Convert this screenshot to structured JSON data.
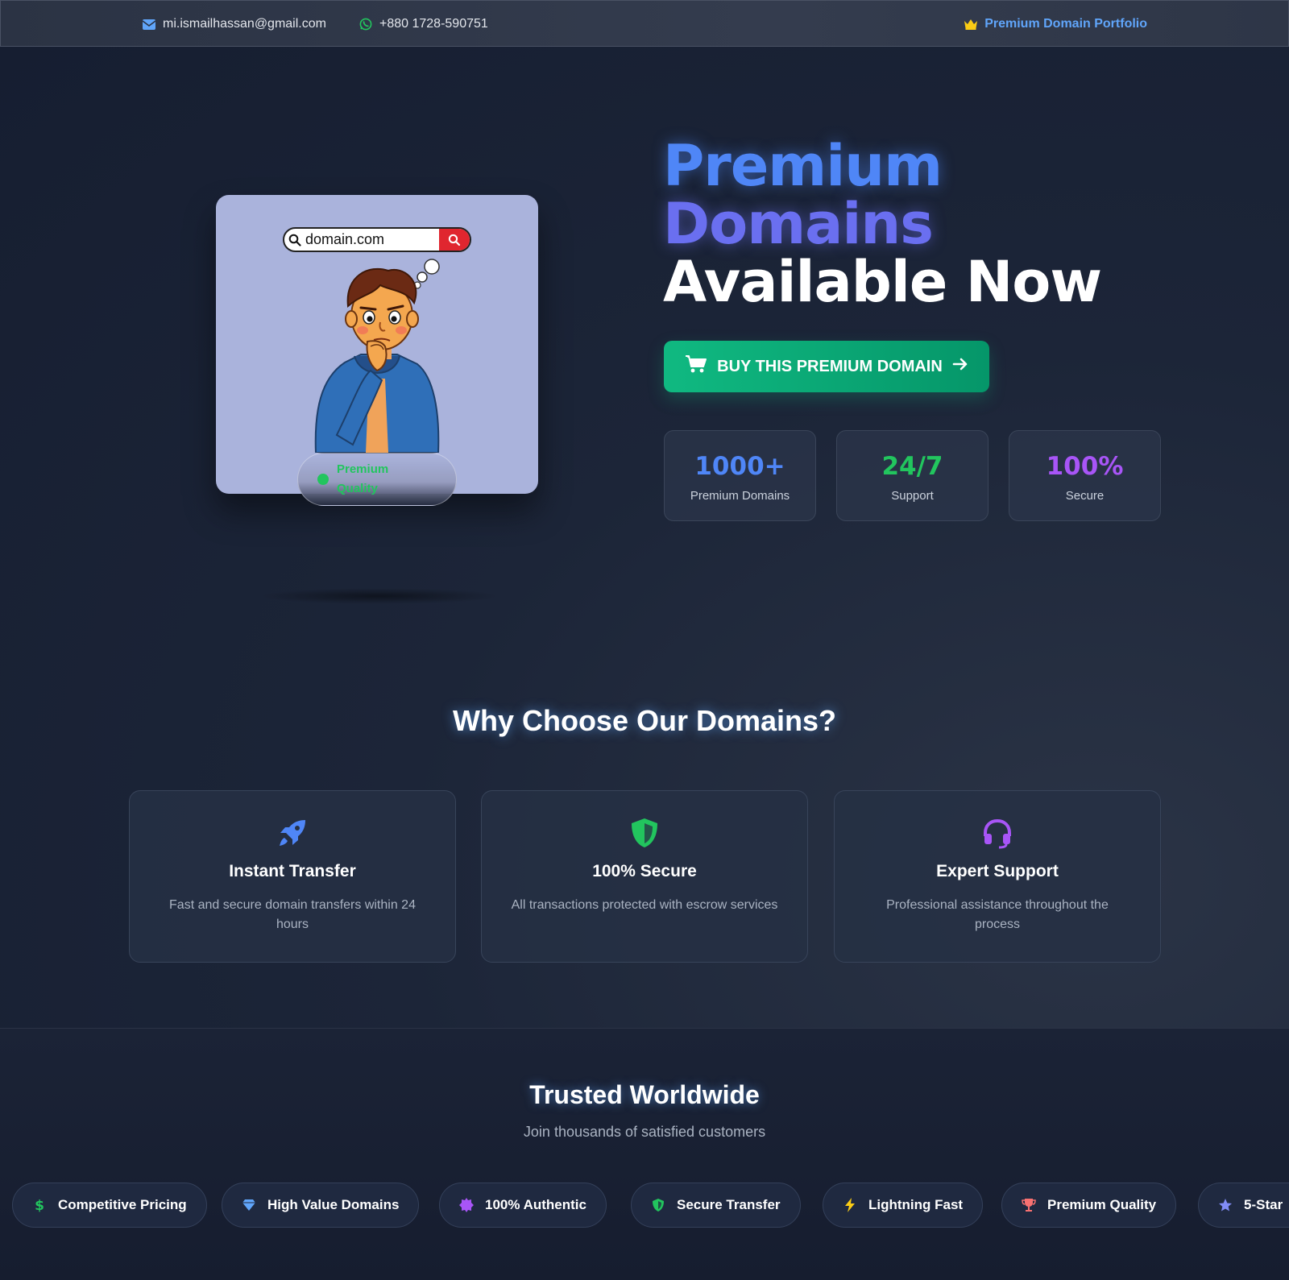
{
  "topbar": {
    "email": "mi.ismailhassan@gmail.com",
    "phone": "+880 1728-590751",
    "portfolio": "Premium Domain Portfolio"
  },
  "hero": {
    "search_text": "domain.com",
    "badge": "Premium Quality",
    "title_line1": "Premium",
    "title_line2": "Domains",
    "title_line3": "Available Now",
    "buy_label": "BUY THIS PREMIUM DOMAIN",
    "stats": [
      {
        "value": "1000+",
        "label": "Premium Domains",
        "color": "#4f86f7"
      },
      {
        "value": "24/7",
        "label": "Support",
        "color": "#22c55e"
      },
      {
        "value": "100%",
        "label": "Secure",
        "color": "#a855f7"
      }
    ]
  },
  "why": {
    "title": "Why Choose Our Domains?",
    "features": [
      {
        "icon": "rocket-icon",
        "title": "Instant Transfer",
        "desc": "Fast and secure domain transfers within 24 hours",
        "color": "#4f86f7"
      },
      {
        "icon": "shield-icon",
        "title": "100% Secure",
        "desc": "All transactions protected with escrow services",
        "color": "#22c55e"
      },
      {
        "icon": "headset-icon",
        "title": "Expert Support",
        "desc": "Professional assistance throughout the process",
        "color": "#a855f7"
      }
    ]
  },
  "trusted": {
    "title": "Trusted Worldwide",
    "subtitle": "Join thousands of satisfied customers",
    "chips": [
      {
        "icon": "dollar-icon",
        "label": "Competitive Pricing",
        "color": "#22c55e"
      },
      {
        "icon": "diamond-icon",
        "label": "High Value Domains",
        "color": "#60a5fa"
      },
      {
        "icon": "certificate-icon",
        "label": "100% Authentic",
        "color": "#a855f7"
      },
      {
        "icon": "shield-icon",
        "label": "Secure Transfer",
        "color": "#22c55e"
      },
      {
        "icon": "bolt-icon",
        "label": "Lightning Fast",
        "color": "#facc15"
      },
      {
        "icon": "trophy-icon",
        "label": "Premium Quality",
        "color": "#f87171"
      },
      {
        "icon": "star-icon",
        "label": "5-Star",
        "color": "#818cf8"
      }
    ]
  }
}
